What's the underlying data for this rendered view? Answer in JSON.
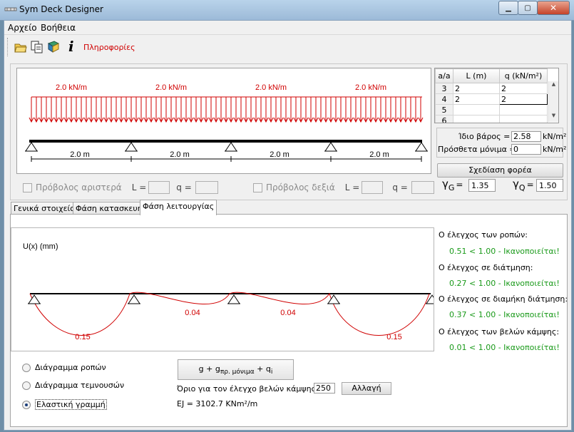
{
  "window": {
    "title": "Sym Deck Designer"
  },
  "menu": [
    "Αρχείο",
    "Βοήθεια"
  ],
  "toolbar": {
    "info_label": "Πληροφορίες",
    "info_glyph": "i"
  },
  "loads": {
    "top_labels": [
      "2.0 kN/m",
      "2.0 kN/m",
      "2.0 kN/m",
      "2.0 kN/m"
    ],
    "span_labels": [
      "2.0 m",
      "2.0 m",
      "2.0 m",
      "2.0 m"
    ]
  },
  "cantilever": {
    "left_label": "Πρόβολος αριστερά",
    "right_label": "Πρόβολος δεξιά",
    "L_label": "L =",
    "q_label": "q ="
  },
  "grid": {
    "headers": [
      "a/a",
      "L (m)",
      "q (kN/m²)"
    ],
    "rows": [
      {
        "n": "3",
        "L": "2",
        "q": "2"
      },
      {
        "n": "4",
        "L": "2",
        "q": "2"
      },
      {
        "n": "5",
        "L": "",
        "q": ""
      },
      {
        "n": "6",
        "L": "",
        "q": ""
      }
    ]
  },
  "weights": {
    "self_label": "Ίδιο βάρος =",
    "self_value": "2.58",
    "self_unit": "kN/m²",
    "extra_label": "Πρόσθετα μόνιμα =",
    "extra_value": "0",
    "extra_unit": "kN/m²"
  },
  "design_button": "Σχεδίαση φορέα",
  "gamma": {
    "g_sym": "γ",
    "g_sub": "G",
    "g_eq": "=",
    "g_value": "1.35",
    "q_sym": "γ",
    "q_sub": "Q",
    "q_eq": "=",
    "q_value": "1.50"
  },
  "tabs": [
    "Γενικά στοιχεία",
    "Φάση κατασκευής",
    "Φάση λειτουργίας"
  ],
  "diagram": {
    "ylabel": "U(x) (mm)",
    "values": [
      "0.15",
      "0.04",
      "0.04",
      "0.15"
    ]
  },
  "checks": [
    {
      "title": "Ο έλεγχος των ροπών:",
      "value": "0.51 < 1.00 - Ικανοποιείται!"
    },
    {
      "title": "Ο έλεγχος σε διάτμηση:",
      "value": "0.27 < 1.00 - Ικανοποιείται!"
    },
    {
      "title": "Ο έλεγχος σε διαμήκη διάτμηση:",
      "value": "0.37 < 1.00 - Ικανοποιείται!"
    },
    {
      "title": "Ο έλεγχος των βελών κάμψης:",
      "value": "0.01 < 1.00 - Ικανοποιείται!"
    }
  ],
  "radios": [
    "Διάγραμμα ροπών",
    "Διάγραμμα τεμνουσών",
    "Ελαστική γραμμή"
  ],
  "formula": {
    "g": "g",
    "plus": "+",
    "g2": "g",
    "g2_sub": "πρ. μόνιμα",
    "plus2": "+",
    "q": "q",
    "q_sub": "i"
  },
  "deflection": {
    "label": "Όριο για τον έλεγχο βελών κάμψης: L /",
    "value": "250",
    "button": "Αλλαγή"
  },
  "ej": {
    "label": "EJ = 3102.7 KNm²/m"
  },
  "colors": {
    "load_red": "#d00000",
    "ok_green": "#1a9a1a"
  }
}
